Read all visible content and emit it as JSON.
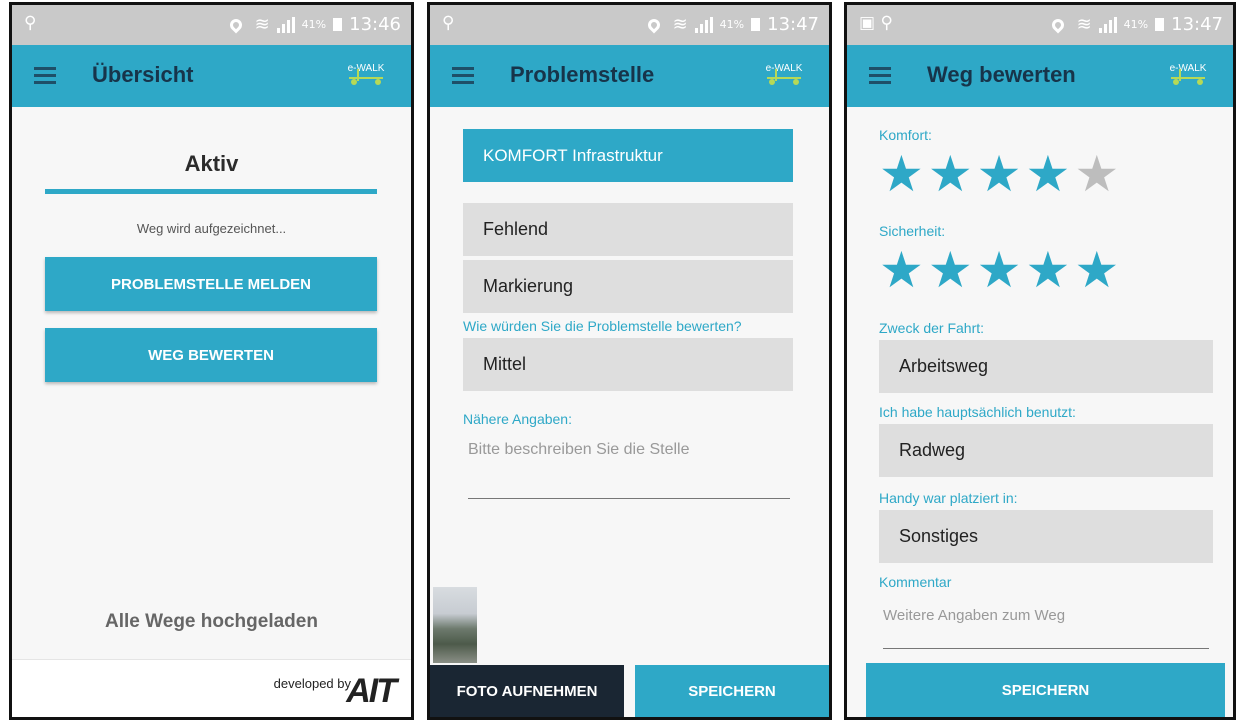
{
  "status": {
    "battery": "41%",
    "times": [
      "13:46",
      "13:47",
      "13:47"
    ]
  },
  "screen1": {
    "title": "Übersicht",
    "logo": "e-WALK",
    "heading": "Aktiv",
    "recording": "Weg wird aufgezeichnet...",
    "report_button": "PROBLEMSTELLE MELDEN",
    "rate_button": "WEG BEWERTEN",
    "uploaded": "Alle Wege hochgeladen",
    "developed_by": "developed by",
    "company": "AIT"
  },
  "screen2": {
    "title": "Problemstelle",
    "logo": "e-WALK",
    "category": "KOMFORT Infrastruktur",
    "option1": "Fehlend",
    "option2": "Markierung",
    "rating_question": "Wie würden Sie die Problemstelle bewerten?",
    "rating_value": "Mittel",
    "details_label": "Nähere Angaben:",
    "details_placeholder": "Bitte beschreiben Sie die Stelle",
    "photo_button": "FOTO AUFNEHMEN",
    "save_button": "SPEICHERN"
  },
  "screen3": {
    "title": "Weg bewerten",
    "logo": "e-WALK",
    "comfort_label": "Komfort:",
    "comfort_rating": 4,
    "safety_label": "Sicherheit:",
    "safety_rating": 5,
    "rating_max": 5,
    "purpose_label": "Zweck der Fahrt:",
    "purpose_value": "Arbeitsweg",
    "used_label": "Ich habe hauptsächlich benutzt:",
    "used_value": "Radweg",
    "phone_label": "Handy war platziert in:",
    "phone_value": "Sonstiges",
    "comment_label": "Kommentar",
    "comment_placeholder": "Weitere Angaben zum Weg",
    "save_button": "SPEICHERN"
  },
  "colors": {
    "accent": "#2ea8c7",
    "star_off": "#bdbdbd",
    "dark_button": "#1a2633"
  }
}
